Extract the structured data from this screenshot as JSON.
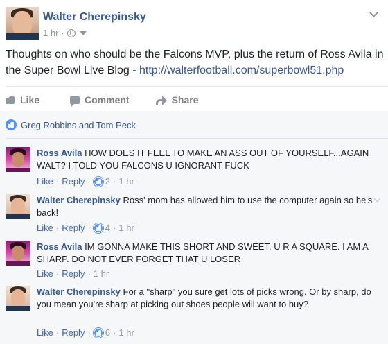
{
  "post": {
    "author": "Walter Cherepinsky",
    "time": "1 hr",
    "meta_separator": "·",
    "text_before_link": "Thoughts on who should be the Falcons MVP, plus the return of Ross Avila in the Super Bowl Live Blog - ",
    "link_text": "http://walterfootball.com/superbowl51.php",
    "privacy_icon": "globe-icon"
  },
  "actions": {
    "like": "Like",
    "comment": "Comment",
    "share": "Share"
  },
  "likes_summary": "Greg Robbins and Tom Peck",
  "comments": [
    {
      "author": "Ross Avila",
      "text": "HOW DOES IT FEEL TO MAKE AN ASS OUT OF YOURSELF...AGAIN WALT? I TOLD YOU FALCONS U IGNORANT FUCK",
      "like_label": "Like",
      "reply_label": "Reply",
      "likes": "2",
      "time": "1 hr"
    },
    {
      "author": "Walter Cherepinsky",
      "text": "Ross' mom has allowed him to use the computer again so he's back!",
      "like_label": "Like",
      "reply_label": "Reply",
      "likes": "4",
      "time": "1 hr"
    },
    {
      "author": "Ross Avila",
      "text": "IM GONNA MAKE THIS SHORT AND SWEET. U R A SQUARE. I AM A SHARP. DO NOT EVER FORGET THAT U LOSER",
      "like_label": "Like",
      "reply_label": "Reply",
      "time": "1 hr"
    },
    {
      "author": "Walter Cherepinsky",
      "text": "For a \"sharp\" you sure get lots of picks wrong. Or by sharp, do you mean you're sharp at picking out shoes people will want to buy?",
      "like_label": "Like",
      "reply_label": "Reply",
      "likes": "6",
      "time": "1 hr"
    }
  ],
  "separator": "·",
  "colors": {
    "link_blue": "#365899",
    "like_blue": "#5890ff",
    "meta_gray": "#90949c",
    "comments_bg": "#f6f7f9"
  }
}
